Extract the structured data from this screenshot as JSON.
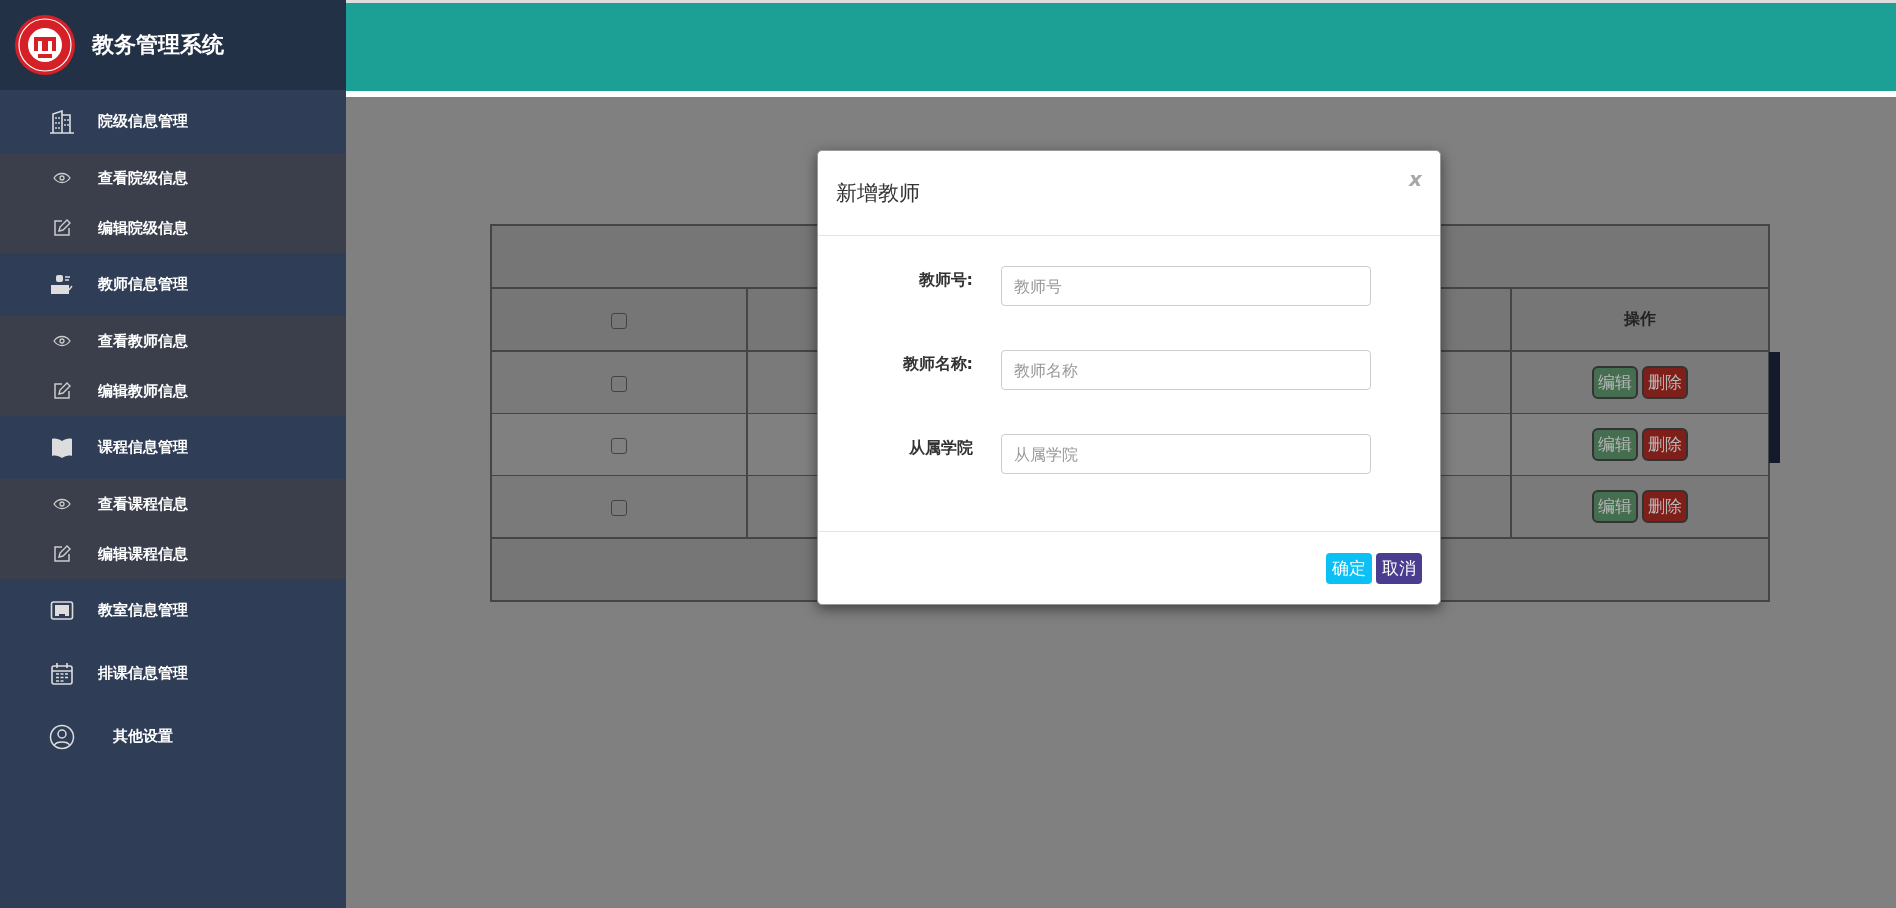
{
  "sidebar": {
    "title": "教务管理系统",
    "menu": [
      {
        "label": "院级信息管理",
        "kind": "building",
        "children": [
          {
            "label": "查看院级信息",
            "kind": "view"
          },
          {
            "label": "编辑院级信息",
            "kind": "edit"
          }
        ]
      },
      {
        "label": "教师信息管理",
        "kind": "teacher",
        "children": [
          {
            "label": "查看教师信息",
            "kind": "view"
          },
          {
            "label": "编辑教师信息",
            "kind": "edit"
          }
        ]
      },
      {
        "label": "课程信息管理",
        "kind": "book",
        "children": [
          {
            "label": "查看课程信息",
            "kind": "view"
          },
          {
            "label": "编辑课程信息",
            "kind": "edit"
          }
        ]
      },
      {
        "label": "教室信息管理",
        "kind": "classroom"
      },
      {
        "label": "排课信息管理",
        "kind": "calendar"
      },
      {
        "label": "其他设置",
        "kind": "user"
      }
    ]
  },
  "table": {
    "header": {
      "checked": false,
      "action_label": "操作"
    },
    "rows": [
      {
        "checked": false,
        "actions": [
          {
            "label": "编辑",
            "kind": "edit"
          },
          {
            "label": "删除",
            "kind": "delete"
          }
        ]
      },
      {
        "checked": false,
        "actions": [
          {
            "label": "编辑",
            "kind": "edit"
          },
          {
            "label": "删除",
            "kind": "delete"
          }
        ]
      },
      {
        "checked": false,
        "actions": [
          {
            "label": "编辑",
            "kind": "edit"
          },
          {
            "label": "删除",
            "kind": "delete"
          }
        ]
      }
    ]
  },
  "dialog": {
    "title": "新增教师",
    "close": "x",
    "fields": [
      {
        "label": "教师号:",
        "placeholder": "教师号"
      },
      {
        "label": "教师名称:",
        "placeholder": "教师名称"
      },
      {
        "label": "从属学院",
        "placeholder": "从属学院"
      }
    ],
    "buttons": [
      {
        "label": "确定",
        "kind": "primary"
      },
      {
        "label": "取消",
        "kind": "cancel"
      }
    ]
  }
}
